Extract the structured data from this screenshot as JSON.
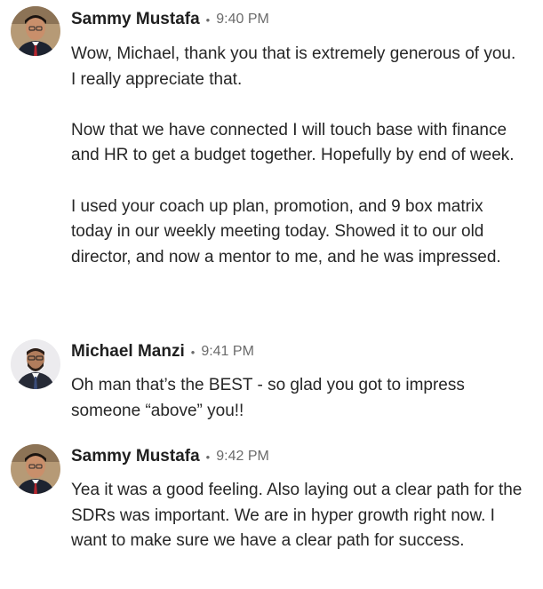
{
  "messages": [
    {
      "sender": "Sammy Mustafa",
      "separator": "•",
      "time": "9:40 PM",
      "paragraphs": [
        "Wow, Michael, thank you that is extremely generous of you. I really appreciate that.",
        "Now that we have connected I will touch base with finance and HR to get a budget together. Hopefully by end of week.",
        "I used your coach up plan, promotion, and 9 box matrix today in our weekly meeting today. Showed it to our old director, and now a mentor to me, and he was impressed."
      ]
    },
    {
      "sender": "Michael Manzi",
      "separator": "•",
      "time": "9:41 PM",
      "paragraphs": [
        "Oh man that’s the BEST - so glad you got to impress someone “above” you!!"
      ]
    },
    {
      "sender": "Sammy Mustafa",
      "separator": "•",
      "time": "9:42 PM",
      "paragraphs": [
        "Yea it was a good feeling. Also laying out a clear path for the SDRs was important. We are in hyper growth right now. I want to make sure we have a clear path for success."
      ]
    }
  ],
  "colors": {
    "text": "#262626",
    "name": "#1f1f1f",
    "meta": "#6b6b6b",
    "background": "#ffffff"
  }
}
